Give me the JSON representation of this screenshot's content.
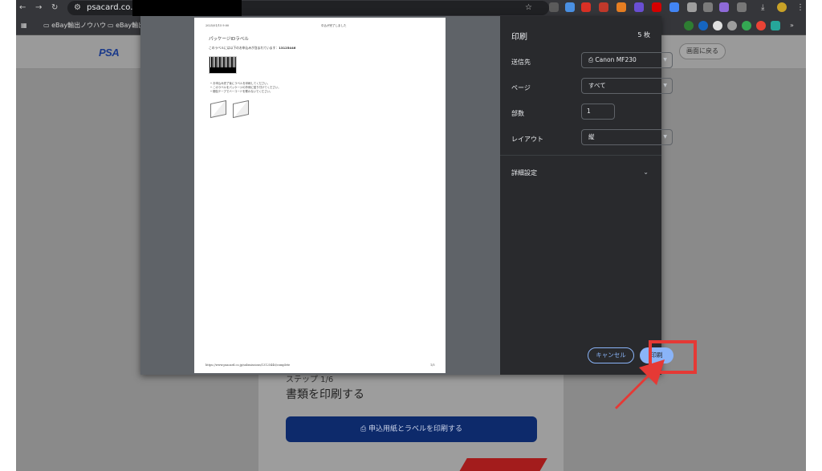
{
  "browser": {
    "url": "psacard.co.jp/",
    "bookmarks": [
      "eBay輸出ノウハウ",
      "eBay輸出"
    ]
  },
  "page": {
    "logo_text": "PSA",
    "back_label": "画面に戻る",
    "step_label": "ステップ 1/6",
    "title": "書類を印刷する",
    "print_button_label": "申込用紙とラベルを印刷する"
  },
  "preview": {
    "header_left": "2025/01/15 9:00",
    "header_right": "中込が完了しました",
    "label_title": "パッケージIDラベル",
    "label_line": "このラベルには以下のお申込みが含まれています：",
    "label_id": "13125446",
    "bullets": [
      "お申込み完了後にラベルを印刷してください。",
      "このラベルをパッケージの外側に貼り付けてください。",
      "梱包テープでバーコードを覆わないでください。"
    ],
    "footer_url": "https://www.psacard.co.jp/submissions/13125446/complete",
    "page_num": "1/5"
  },
  "print_dialog": {
    "title": "印刷",
    "sheet_count": "5 枚",
    "destination_label": "送信先",
    "destination_value": "Canon MF230",
    "pages_label": "ページ",
    "pages_value": "すべて",
    "copies_label": "部数",
    "copies_value": "1",
    "layout_label": "レイアウト",
    "layout_value": "縦",
    "advanced_label": "詳細設定",
    "cancel_label": "キャンセル",
    "print_label": "印刷"
  },
  "icons": {
    "back": "arrow-left-icon",
    "forward": "arrow-right-icon",
    "reload": "reload-icon",
    "printer": "printer-icon",
    "chevron": "chevron-down-icon"
  },
  "colors": {
    "highlight": "#e53935",
    "accent": "#8ab4f8",
    "psa_blue": "#0d2a6b"
  }
}
